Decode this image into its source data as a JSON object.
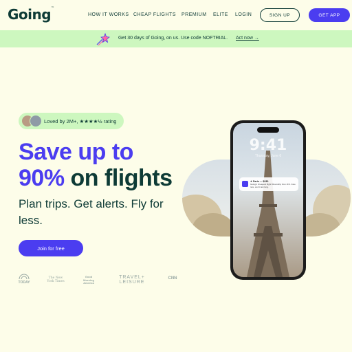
{
  "nav": {
    "logo": "Going",
    "logo_tm": "™",
    "links": [
      "HOW IT WORKS",
      "CHEAP FLIGHTS",
      "PREMIUM",
      "ELITE",
      "LOGIN"
    ],
    "signup_label": "SIGN UP",
    "getapp_label": "GET APP"
  },
  "promo": {
    "text": "Get 30 days of Going, on us. Use code NOFTRIAL.",
    "link": "Act now →"
  },
  "hero": {
    "social_proof": "Loved by 2M+, ★★★★½ rating",
    "headline_line1": "Save up to",
    "headline_line2_accent": "90%",
    "headline_line2_rest": " on flights",
    "sub_line1": "Plan trips. Get alerts. Fly for",
    "sub_line2": "less.",
    "cta_label": "Join for free"
  },
  "press": [
    "TODAY",
    "The New York Times",
    "Good Morning America",
    "TRAVEL+ LEISURE",
    "CNN"
  ],
  "phone": {
    "time": "9:41",
    "date": "Thursday, June 6",
    "notif_title": "✈ Paris — $230",
    "notif_body": "Going’s cheapest flight! Roundtrip from JFK. Fare rare, won’t last long."
  },
  "colors": {
    "background": "#fdfde9",
    "primary": "#4b3df0",
    "dark_text": "#0e3b36",
    "promo_bar": "#cdf7bf"
  }
}
